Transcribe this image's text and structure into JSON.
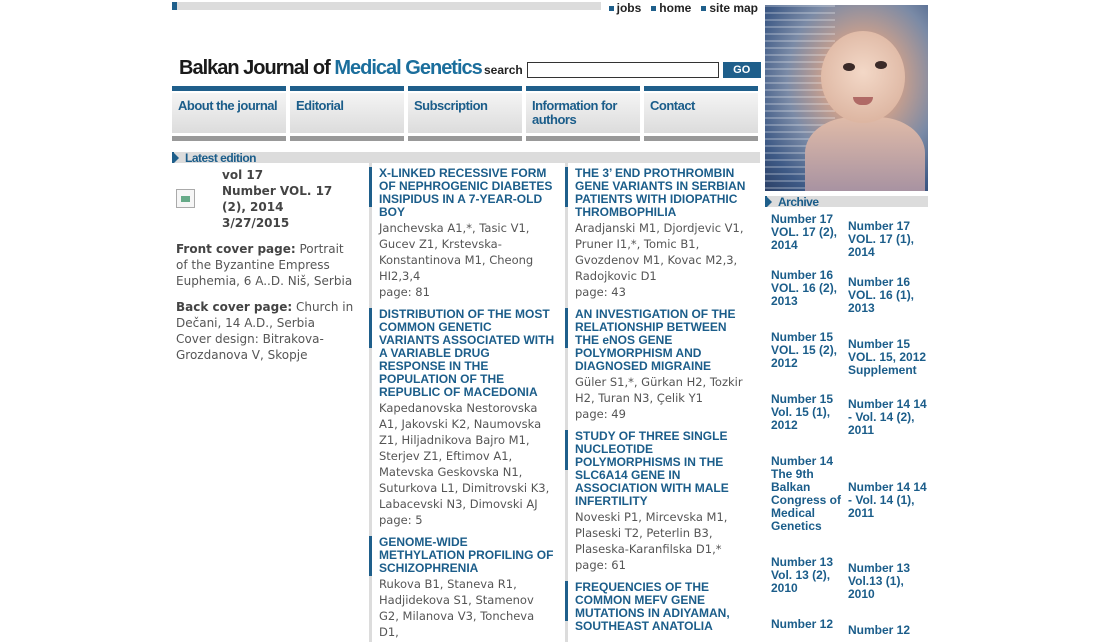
{
  "top_links": [
    "jobs",
    "home",
    "site map"
  ],
  "logo": {
    "dark": "Balkan Journal of ",
    "accent": "Medical Genetics"
  },
  "search": {
    "label": "search",
    "value": "",
    "button": "GO"
  },
  "nav": [
    "About the journal",
    "Editorial",
    "Subscription",
    "Information for authors",
    "Contact"
  ],
  "latest": {
    "header": "Latest edition",
    "vol": "vol 17",
    "number": "Number VOL. 17 (2), 2014",
    "date": "3/27/2015",
    "front_label": "Front cover page:",
    "front_text": " Portrait of the Byzantine Empress Euphemia, 6 A..D. Niš, Serbia",
    "back_label": "Back cover page:",
    "back_text": " Church in Dečani, 14 A.D., Serbia",
    "design": "Cover design: Bitrakova-Grozdanova V, Skopje"
  },
  "articles_col1": [
    {
      "title": "X-LINKED RECESSIVE FORM OF NEPHROGENIC DIABETES INSIPIDUS IN A 7-YEAR-OLD BOY",
      "authors": "Janchevska A1,*, Tasic V1, Gucev Z1, Krstevska-Konstantinova M1, Cheong HI2,3,4",
      "page": "page: 81"
    },
    {
      "title": "DISTRIBUTION OF THE MOST COMMON GENETIC VARIANTS ASSOCIATED WITH A VARIABLE DRUG RESPONSE IN THE POPULATION OF THE REPUBLIC OF MACEDONIA",
      "authors": "Kapedanovska Nestorovska A1, Jakovski K2, Naumovska Z1, Hiljadnikova Bajro M1, Sterjev Z1, Eftimov A1, Matevska Geskovska N1, Suturkova L1, Dimitrovski K3, Labacevski N3, Dimovski AJ",
      "page": "page: 5"
    },
    {
      "title": "GENOME-WIDE METHYLATION PROFILING OF SCHIZOPHRENIA",
      "authors": "Rukova B1, Staneva R1, Hadjidekova S1, Stamenov G2, Milanova V3, Toncheva D1,",
      "page": ""
    }
  ],
  "articles_col2": [
    {
      "title": "THE 3’ END PROTHROMBIN GENE VARIANTS IN SERBIAN PATIENTS WITH IDIOPATHIC THROMBOPHILIA",
      "authors": "Aradjanski M1, Djordjevic V1, Pruner I1,*, Tomic B1, Gvozdenov M1, Kovac M2,3, Radojkovic D1",
      "page": "page: 43"
    },
    {
      "title": "AN INVESTIGATION OF THE RELATIONSHIP BETWEEN THE eNOS GENE POLYMORPHISM AND DIAGNOSED MIGRAINE",
      "authors": "Güler S1,*, Gürkan H2, Tozkir H2, Turan N3, Çelik Y1",
      "page": "page: 49"
    },
    {
      "title": "STUDY OF THREE SINGLE NUCLEOTIDE POLYMORPHISMS IN THE SLC6A14 GENE IN ASSOCIATION WITH MALE INFERTILITY",
      "authors": "Noveski P1, Mircevska M1, Plaseski T2, Peterlin B3, Plaseska-Karanfilska D1,*",
      "page": "page: 61"
    },
    {
      "title": "FREQUENCIES OF THE COMMON MEFV GENE MUTATIONS IN ADIYAMAN, SOUTHEAST ANATOLIA",
      "authors": "",
      "page": ""
    }
  ],
  "archive": {
    "header": "Archive",
    "left": [
      "Number 17 VOL. 17 (2), 2014",
      "Number 16 VOL. 16 (2), 2013",
      "Number 15 VOL. 15 (2), 2012",
      "Number 15 Vol. 15 (1), 2012",
      "Number 14 The 9th Balkan Congress of Medical Genetics",
      "Number 13 Vol. 13 (2), 2010",
      "Number 12"
    ],
    "right": [
      "Number 17 VOL. 17 (1), 2014",
      "Number 16 VOL. 16 (1), 2013",
      "Number 15 VOL. 15, 2012 Supplement",
      "Number 14 14 - Vol. 14 (2), 2011",
      "Number 14 14 - Vol. 14 (1), 2011",
      "Number 13 Vol.13 (1), 2010",
      "Number 12"
    ]
  },
  "colors": {
    "accent": "#1b5d8a",
    "bar": "#1f5f8b",
    "gray": "#dcdcdc"
  }
}
